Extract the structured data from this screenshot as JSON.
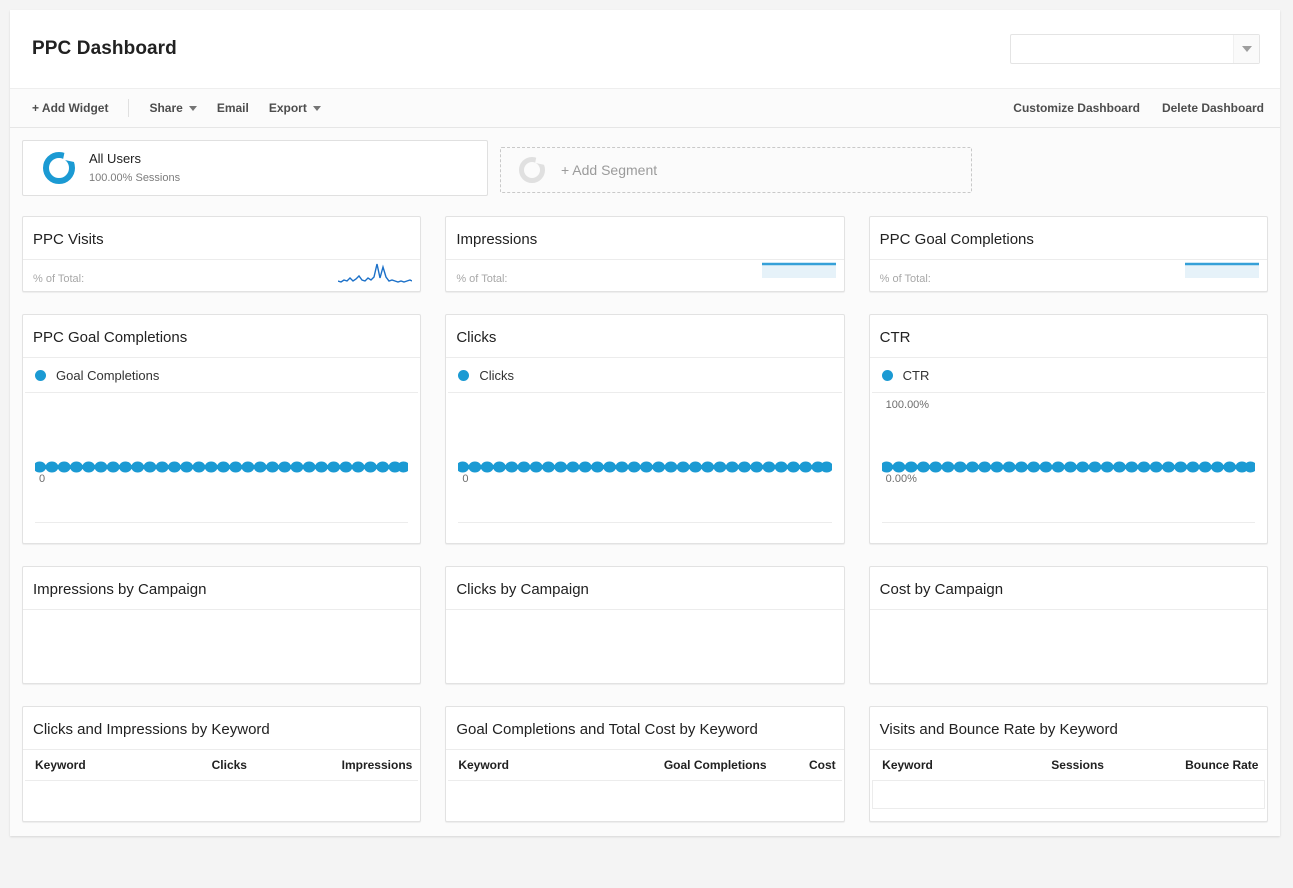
{
  "header": {
    "title": "PPC Dashboard",
    "profile_select_value": "",
    "caret_icon": "chevron-down-icon"
  },
  "toolbar": {
    "left_items": [
      {
        "label": "+ Add Widget",
        "has_caret": false
      },
      {
        "label": "Share",
        "has_caret": true
      },
      {
        "label": "Email",
        "has_caret": false
      },
      {
        "label": "Export",
        "has_caret": true
      }
    ],
    "right_items": [
      {
        "label": "Customize Dashboard"
      },
      {
        "label": "Delete Dashboard"
      }
    ]
  },
  "segments": {
    "active": {
      "name": "All Users",
      "sub": "100.00% Sessions",
      "icon": "donut-icon",
      "accent": "#1b9ad3"
    },
    "add": {
      "label": "+ Add Segment",
      "icon": "donut-outline-icon"
    }
  },
  "metric_widgets": [
    {
      "title": "PPC Visits",
      "pct_label": "% of Total:",
      "spark": "jagged"
    },
    {
      "title": "Impressions",
      "pct_label": "% of Total:",
      "spark": "flat"
    },
    {
      "title": "PPC Goal Completions",
      "pct_label": "% of Total:",
      "spark": "flat"
    }
  ],
  "chart_widgets": [
    {
      "title": "PPC Goal Completions",
      "legend": "Goal Completions",
      "top_label": "",
      "zero_label": "0"
    },
    {
      "title": "Clicks",
      "legend": "Clicks",
      "top_label": "",
      "zero_label": "0"
    },
    {
      "title": "CTR",
      "legend": "CTR",
      "top_label": "100.00%",
      "zero_label": "0.00%"
    }
  ],
  "campaign_widgets": [
    {
      "title": "Impressions by Campaign"
    },
    {
      "title": "Clicks by Campaign"
    },
    {
      "title": "Cost by Campaign"
    }
  ],
  "table_widgets": [
    {
      "title": "Clicks and Impressions by Keyword",
      "columns": [
        "Keyword",
        "Clicks",
        "Impressions"
      ],
      "rows": [],
      "show_empty_row_border": false
    },
    {
      "title": "Goal Completions and Total Cost by Keyword",
      "columns": [
        "Keyword",
        "Goal Completions",
        "Cost"
      ],
      "rows": [],
      "show_empty_row_border": false
    },
    {
      "title": "Visits and Bounce Rate by Keyword",
      "columns": [
        "Keyword",
        "Sessions",
        "Bounce Rate"
      ],
      "rows": [],
      "show_empty_row_border": true
    }
  ],
  "chart_data": {
    "type": "line",
    "title": "PPC dashboard time-series widgets",
    "charts": [
      {
        "name": "PPC Goal Completions",
        "series": [
          {
            "name": "Goal Completions",
            "color": "#1b9ad3",
            "values": [
              0,
              0,
              0,
              0,
              0,
              0,
              0,
              0,
              0,
              0,
              0,
              0,
              0,
              0,
              0,
              0,
              0,
              0,
              0,
              0,
              0,
              0,
              0,
              0,
              0,
              0,
              0,
              0,
              0,
              0,
              0
            ]
          }
        ],
        "ylim": [
          0,
          1
        ],
        "ytick_labels": [
          "0"
        ],
        "grid": true,
        "markers": true,
        "point_count": 31
      },
      {
        "name": "Clicks",
        "series": [
          {
            "name": "Clicks",
            "color": "#1b9ad3",
            "values": [
              0,
              0,
              0,
              0,
              0,
              0,
              0,
              0,
              0,
              0,
              0,
              0,
              0,
              0,
              0,
              0,
              0,
              0,
              0,
              0,
              0,
              0,
              0,
              0,
              0,
              0,
              0,
              0,
              0,
              0,
              0
            ]
          }
        ],
        "ylim": [
          0,
          1
        ],
        "ytick_labels": [
          "0"
        ],
        "grid": true,
        "markers": true,
        "point_count": 31
      },
      {
        "name": "CTR",
        "series": [
          {
            "name": "CTR",
            "color": "#1b9ad3",
            "values": [
              0,
              0,
              0,
              0,
              0,
              0,
              0,
              0,
              0,
              0,
              0,
              0,
              0,
              0,
              0,
              0,
              0,
              0,
              0,
              0,
              0,
              0,
              0,
              0,
              0,
              0,
              0,
              0,
              0,
              0,
              0
            ]
          }
        ],
        "ylim": [
          0,
          100
        ],
        "ytick_labels": [
          "0.00%",
          "100.00%"
        ],
        "grid": true,
        "markers": true,
        "point_count": 31
      }
    ],
    "sparklines": [
      {
        "name": "PPC Visits",
        "color": "#1b70c8",
        "values": [
          3,
          2,
          4,
          3,
          5,
          3,
          4,
          6,
          4,
          3,
          5,
          4,
          6,
          14,
          4,
          12,
          6,
          3,
          4,
          3,
          2,
          3,
          2,
          3,
          4,
          3,
          2,
          3
        ]
      },
      {
        "name": "Impressions",
        "color": "#35a0d8",
        "values": [
          0,
          0,
          0,
          0,
          0,
          0,
          0,
          0,
          0,
          0,
          0,
          0,
          0,
          0,
          0,
          0,
          0,
          0,
          0,
          0
        ]
      },
      {
        "name": "PPC Goal Completions",
        "color": "#35a0d8",
        "values": [
          0,
          0,
          0,
          0,
          0,
          0,
          0,
          0,
          0,
          0,
          0,
          0,
          0,
          0,
          0,
          0,
          0,
          0,
          0,
          0
        ]
      }
    ]
  }
}
